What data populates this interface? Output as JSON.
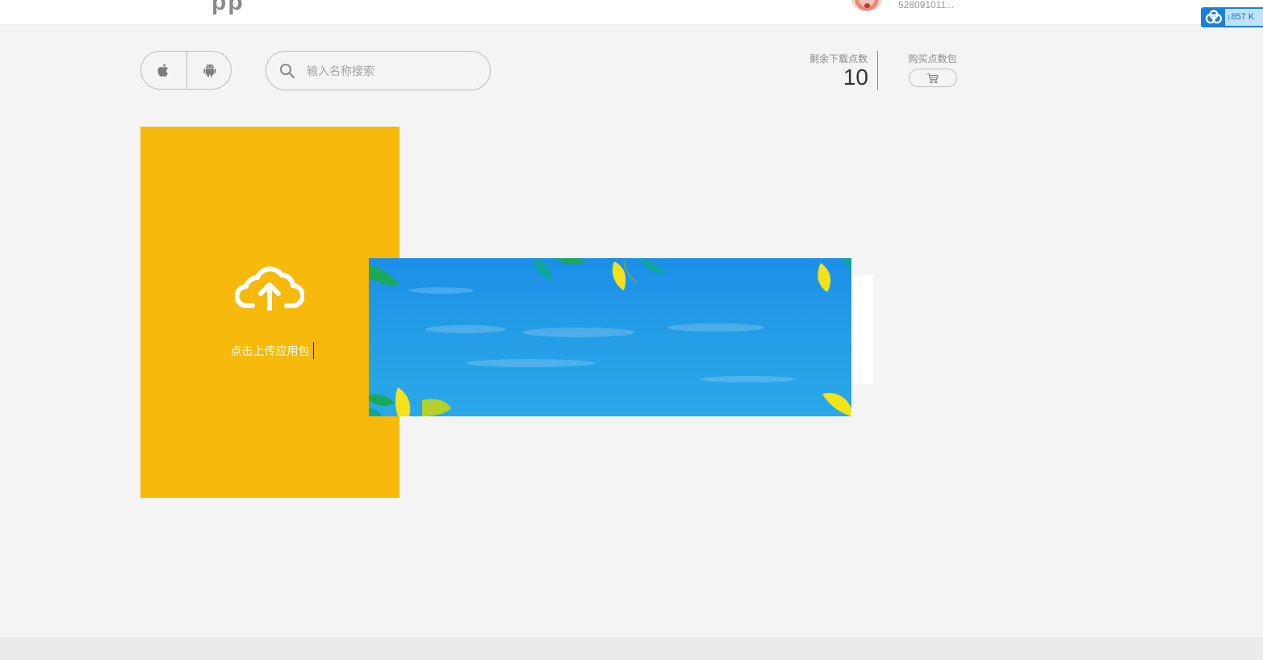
{
  "header": {
    "logo_fragment": "pp",
    "username": "528091011..."
  },
  "speed_widget": {
    "rate": "857 K",
    "icon": "cloud-download-icon"
  },
  "toolbar": {
    "platforms": [
      {
        "name": "apple",
        "icon": "apple-icon"
      },
      {
        "name": "android",
        "icon": "android-icon"
      }
    ],
    "search_placeholder": "输入名称搜索"
  },
  "points": {
    "label": "剩余下载点数",
    "value": "10",
    "buy_label": "购买点数包",
    "cart_icon": "cart-icon"
  },
  "upload": {
    "label": "点击上传应用包",
    "icon": "cloud-upload-icon",
    "background": "#f6b90c"
  },
  "banner": {
    "background": "#1b8fe8",
    "leaf_colors": [
      "#1aa85a",
      "#f3e21a",
      "#10a6a0"
    ]
  }
}
